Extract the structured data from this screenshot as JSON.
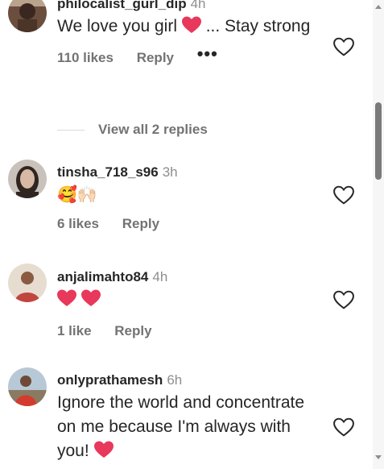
{
  "comments": [
    {
      "username": "philocalist_gurl_dip",
      "time": "4h",
      "text_before": "We love you girl",
      "text_after": "... Stay strong",
      "likes": "110 likes",
      "reply": "Reply",
      "more": "•••"
    },
    {
      "username": "tinsha_718_s96",
      "time": "3h",
      "emojis": "🥰🙌🏻",
      "likes": "6 likes",
      "reply": "Reply"
    },
    {
      "username": "anjalimahto84",
      "time": "4h",
      "likes": "1 like",
      "reply": "Reply"
    },
    {
      "username": "onlyprathamesh",
      "time": "6h",
      "text": "Ignore the world and concentrate on me because I'm always with you!"
    }
  ],
  "view_replies": "View all 2 replies",
  "colors": {
    "heart": "#e8385b",
    "muted": "#737373",
    "text": "#262626"
  },
  "icons": {
    "like": "heart-outline-icon",
    "emoji_heart": "red-heart-emoji"
  }
}
